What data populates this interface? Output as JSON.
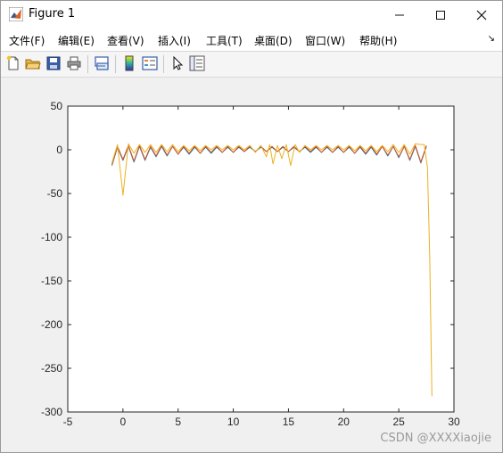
{
  "window": {
    "title": "Figure 1",
    "minimize_icon": "minimize-icon",
    "maximize_icon": "maximize-icon",
    "close_icon": "close-icon"
  },
  "menubar": {
    "items": [
      "文件(F)",
      "编辑(E)",
      "查看(V)",
      "插入(I)",
      "工具(T)",
      "桌面(D)",
      "窗口(W)",
      "帮助(H)"
    ]
  },
  "toolbar": {
    "icons": [
      "new-figure-icon",
      "open-file-icon",
      "save-icon",
      "print-icon",
      "link-plot-icon",
      "colorbar-icon",
      "legend-icon",
      "pointer-icon",
      "property-editor-icon"
    ]
  },
  "watermark": "CSDN @XXXXiaojie",
  "chart_data": {
    "type": "line",
    "title": "",
    "xlabel": "",
    "ylabel": "",
    "xlim": [
      -5,
      30
    ],
    "ylim": [
      -300,
      50
    ],
    "xticks": [
      "-5",
      "0",
      "5",
      "10",
      "15",
      "20",
      "25",
      "30"
    ],
    "yticks": [
      "50",
      "0",
      "-50",
      "-100",
      "-150",
      "-200",
      "-250",
      "-300"
    ],
    "grid": false,
    "series": [
      {
        "color": "#0072bd",
        "x": [
          -1,
          -0.5,
          0,
          0.5,
          1,
          1.5,
          2,
          2.5,
          3,
          3.5,
          4,
          4.5,
          5,
          5.5,
          6,
          6.5,
          7,
          7.5,
          8,
          8.5,
          9,
          9.5,
          10,
          10.5,
          11,
          11.5,
          12,
          12.5,
          13,
          13.5,
          14,
          14.5,
          15,
          15.5,
          16,
          16.5,
          17,
          17.5,
          18,
          18.5,
          19,
          19.5,
          20,
          20.5,
          21,
          21.5,
          22,
          22.5,
          23,
          23.5,
          24,
          24.5,
          25,
          25.5,
          26,
          26.5,
          27,
          27.5
        ],
        "y": [
          -18,
          3,
          -12,
          4,
          -14,
          4,
          -12,
          3,
          -8,
          4,
          -7,
          4,
          -5,
          3,
          -5,
          3,
          -4,
          3,
          -4,
          3,
          -3,
          3,
          -3,
          3,
          -2,
          3,
          -2,
          3,
          -2,
          3,
          -2,
          3,
          -2,
          3,
          -2,
          3,
          -3,
          3,
          -3,
          3,
          -3,
          3,
          -3,
          3,
          -4,
          3,
          -5,
          3,
          -6,
          4,
          -7,
          4,
          -9,
          4,
          -12,
          4,
          -15,
          4
        ]
      },
      {
        "color": "#d95319",
        "x": [
          -1,
          -0.5,
          0,
          0.5,
          1,
          1.5,
          2,
          2.5,
          3,
          3.5,
          4,
          4.5,
          5,
          5.5,
          6,
          6.5,
          7,
          7.5,
          8,
          8.5,
          9,
          9.5,
          10,
          10.5,
          11,
          11.5,
          12,
          12.5,
          13,
          13.5,
          14,
          14.5,
          15,
          15.5,
          16,
          16.5,
          17,
          17.5,
          18,
          18.5,
          19,
          19.5,
          20,
          20.5,
          21,
          21.5,
          22,
          22.5,
          23,
          23.5,
          24,
          24.5,
          25,
          25.5,
          26,
          26.5,
          27,
          27.5
        ],
        "y": [
          -17,
          4,
          -11,
          5,
          -13,
          5,
          -11,
          4,
          -7,
          5,
          -6,
          4,
          -5,
          4,
          -4,
          4,
          -4,
          4,
          -3,
          4,
          -3,
          4,
          -3,
          4,
          -2,
          4,
          -2,
          4,
          -2,
          4,
          -2,
          4,
          -2,
          4,
          -2,
          4,
          -2,
          4,
          -3,
          4,
          -3,
          4,
          -3,
          4,
          -4,
          4,
          -4,
          4,
          -5,
          4,
          -6,
          4,
          -8,
          4,
          -11,
          5,
          -14,
          5
        ]
      },
      {
        "color": "#edb120",
        "x": [
          -1,
          -0.5,
          0,
          0.5,
          1,
          1.5,
          2,
          2.5,
          3,
          3.5,
          4,
          4.5,
          5,
          5.5,
          6,
          6.5,
          7,
          7.5,
          8,
          8.5,
          9,
          9.5,
          10,
          10.5,
          11,
          11.5,
          12,
          12.5,
          13,
          13.3,
          13.6,
          14,
          14.4,
          14.8,
          15.2,
          15.6,
          16,
          16.5,
          17,
          17.5,
          18,
          18.5,
          19,
          19.5,
          20,
          20.5,
          21,
          21.5,
          22,
          22.5,
          23,
          23.5,
          24,
          24.5,
          25,
          25.5,
          26,
          26.5,
          27,
          27.3,
          27.6,
          27.8,
          28
        ],
        "y": [
          -15,
          6,
          -52,
          7,
          -4,
          6,
          -3,
          6,
          -3,
          6,
          -2,
          6,
          -2,
          5,
          -1,
          5,
          -1,
          5,
          0,
          5,
          0,
          5,
          0,
          5,
          0,
          5,
          -3,
          5,
          -8,
          6,
          -16,
          5,
          -10,
          6,
          -18,
          6,
          -3,
          5,
          0,
          5,
          0,
          5,
          0,
          5,
          0,
          5,
          -1,
          5,
          -1,
          5,
          -2,
          5,
          -2,
          6,
          -3,
          6,
          -5,
          7,
          6,
          6,
          -20,
          -120,
          -282
        ]
      }
    ]
  }
}
